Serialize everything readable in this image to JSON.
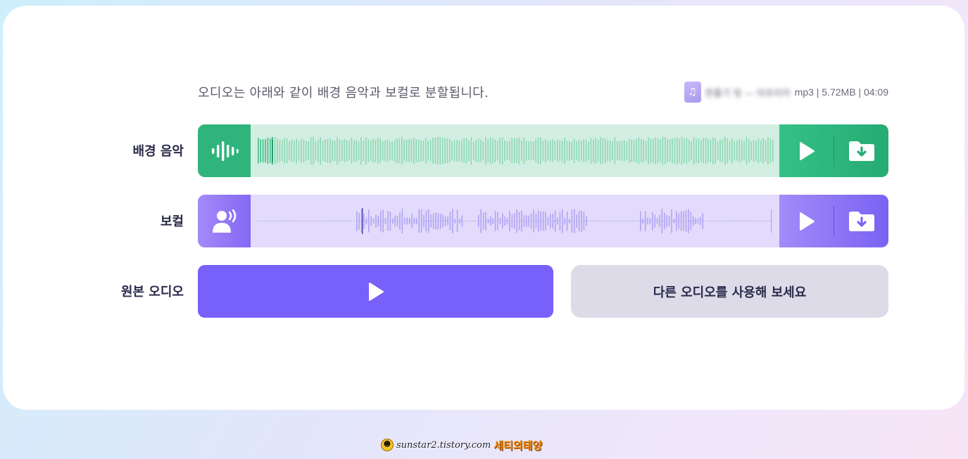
{
  "intro_text": "오디오는 아래와 같이 배경 음악과 보컬로 분할됩니다.",
  "file": {
    "name": "한풀기 빛 — 아프리카",
    "meta": "mp3 | 5.72MB | 04:09",
    "icon": "music-file-icon"
  },
  "tracks": {
    "music": {
      "label": "배경 음악",
      "icon": "waveform-icon",
      "play_icon": "play-icon",
      "download_icon": "download-folder-icon",
      "accent": "#2fb57c"
    },
    "vocal": {
      "label": "보컬",
      "icon": "speaking-person-icon",
      "play_icon": "play-icon",
      "download_icon": "download-folder-icon",
      "accent": "#8468f5"
    }
  },
  "original": {
    "label": "원본 오디오",
    "play_icon": "play-icon",
    "accent": "#7860fa"
  },
  "other_audio_button": "다른 오디오를 사용해 보세요",
  "watermark": {
    "url": "sunstar2.tistory.com",
    "name": "세티의태양"
  }
}
